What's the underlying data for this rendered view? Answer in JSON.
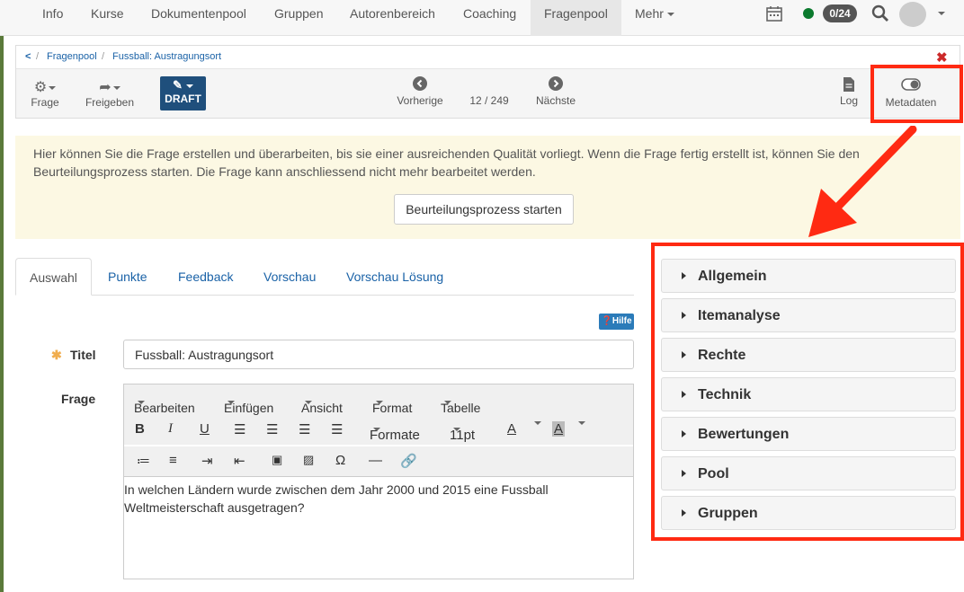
{
  "topnav": {
    "items": [
      "Info",
      "Kurse",
      "Dokumentenpool",
      "Gruppen",
      "Autorenbereich",
      "Coaching",
      "Fragenpool",
      "Mehr"
    ],
    "badge": "0/24"
  },
  "breadcrumb": {
    "back": "<",
    "items": [
      "Fragenpool",
      "Fussball: Austragungsort"
    ]
  },
  "toolbar": {
    "frage": "Frage",
    "freigeben": "Freigeben",
    "draft": "DRAFT",
    "prev": "Vorherige",
    "counter": "12 / 249",
    "next": "Nächste",
    "log": "Log",
    "metadaten": "Metadaten"
  },
  "info": {
    "text": "Hier können Sie die Frage erstellen und überarbeiten, bis sie einer ausreichenden Qualität vorliegt. Wenn die Frage fertig erstellt ist, können Sie den Beurteilungsprozess starten. Die Frage kann anschliessend nicht mehr bearbeitet werden.",
    "button": "Beurteilungsprozess starten"
  },
  "tabs": [
    "Auswahl",
    "Punkte",
    "Feedback",
    "Vorschau",
    "Vorschau Lösung"
  ],
  "hilfe": "Hilfe",
  "form": {
    "titel_label": "Titel",
    "titel_value": "Fussball: Austragungsort",
    "frage_label": "Frage"
  },
  "editor": {
    "menu": [
      "Bearbeiten",
      "Einfügen",
      "Ansicht",
      "Format",
      "Tabelle"
    ],
    "formate": "Formate",
    "size": "11pt",
    "content": "In welchen Ländern wurde zwischen dem Jahr 2000 und 2015 eine Fussball Weltmeisterschaft ausgetragen?"
  },
  "accordion": [
    "Allgemein",
    "Itemanalyse",
    "Rechte",
    "Technik",
    "Bewertungen",
    "Pool",
    "Gruppen"
  ],
  "colors": {
    "highlight": "#ff2a12",
    "link": "#1a62a7",
    "draft": "#1f4f7c"
  }
}
